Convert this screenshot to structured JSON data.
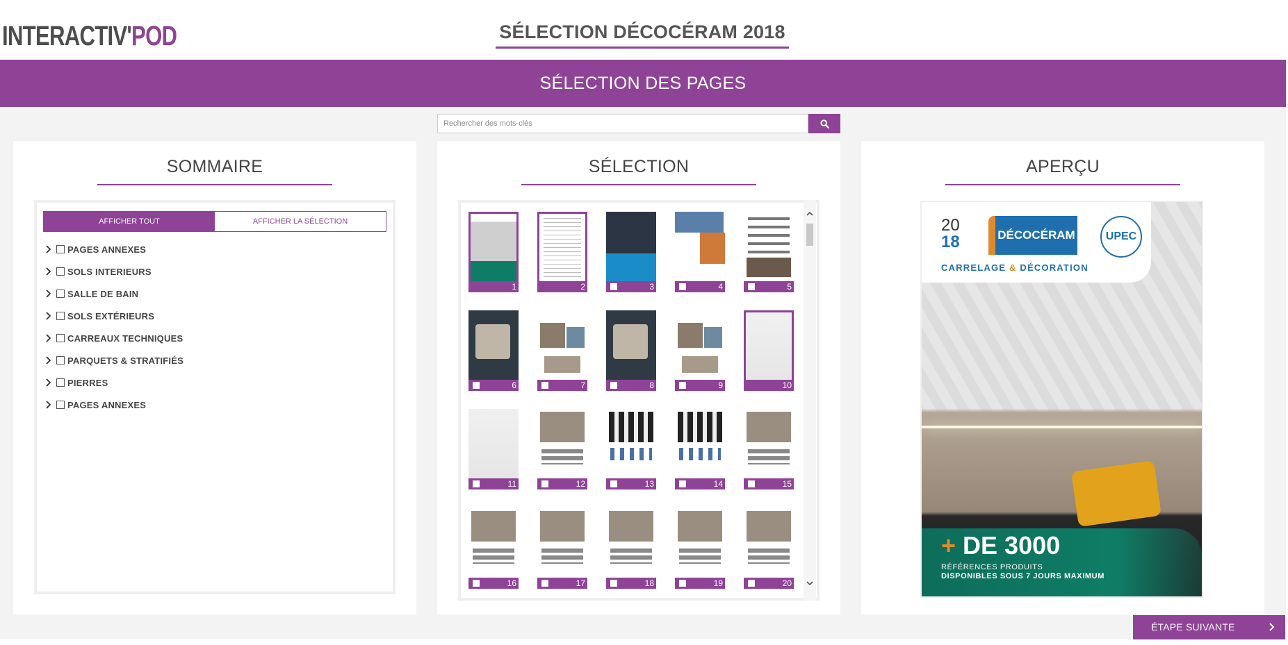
{
  "logo": {
    "part1": "INTERACTIV'",
    "part2": "POD"
  },
  "document_title": "SÉLECTION DÉCOCÉRAM 2018",
  "banner_title": "SÉLECTION DES PAGES",
  "search": {
    "placeholder": "Rechercher des mots-clés",
    "value": ""
  },
  "sommaire": {
    "title": "SOMMAIRE",
    "tabs": [
      {
        "label": "AFFICHER TOUT",
        "active": true
      },
      {
        "label": "AFFICHER LA SÉLECTION",
        "active": false
      }
    ],
    "items": [
      {
        "label": "PAGES ANNEXES"
      },
      {
        "label": "SOLS INTERIEURS"
      },
      {
        "label": "SALLE DE BAIN"
      },
      {
        "label": "SOLS EXTÉRIEURS"
      },
      {
        "label": "CARREAUX TECHNIQUES"
      },
      {
        "label": "PARQUETS & STRATIFIÉS"
      },
      {
        "label": "PIERRES"
      },
      {
        "label": "PAGES ANNEXES"
      }
    ]
  },
  "selection": {
    "title": "SÉLECTION",
    "pages": [
      {
        "num": "1",
        "selected": true,
        "style": "cover"
      },
      {
        "num": "2",
        "selected": true,
        "style": "text"
      },
      {
        "num": "3",
        "selected": false,
        "style": "dark-blue"
      },
      {
        "num": "4",
        "selected": false,
        "style": "city"
      },
      {
        "num": "5",
        "selected": false,
        "style": "brands"
      },
      {
        "num": "6",
        "selected": false,
        "style": "dark"
      },
      {
        "num": "7",
        "selected": false,
        "style": "collage"
      },
      {
        "num": "8",
        "selected": false,
        "style": "dark"
      },
      {
        "num": "9",
        "selected": false,
        "style": "collage"
      },
      {
        "num": "10",
        "selected": true,
        "style": "faded"
      },
      {
        "num": "11",
        "selected": false,
        "style": "faded"
      },
      {
        "num": "12",
        "selected": false,
        "style": "catalog"
      },
      {
        "num": "13",
        "selected": false,
        "style": "catalog-dots"
      },
      {
        "num": "14",
        "selected": false,
        "style": "catalog-dots"
      },
      {
        "num": "15",
        "selected": false,
        "style": "catalog"
      },
      {
        "num": "16",
        "selected": false,
        "style": "catalog"
      },
      {
        "num": "17",
        "selected": false,
        "style": "catalog"
      },
      {
        "num": "18",
        "selected": false,
        "style": "catalog"
      },
      {
        "num": "19",
        "selected": false,
        "style": "catalog"
      },
      {
        "num": "20",
        "selected": false,
        "style": "catalog"
      }
    ]
  },
  "apercu": {
    "title": "APERÇU",
    "year_top": "20",
    "year_bottom": "18",
    "brand": "DÉCOCÉRAM",
    "badge": "UPEC",
    "tagline_1": "CARRELAGE ",
    "tagline_amp": "&",
    "tagline_2": " DÉCORATION",
    "plus_sign": "+",
    "plus_text": " DE 3000",
    "refs_line1": "RÉFÉRENCES PRODUITS",
    "refs_line2": "DISPONIBLES SOUS 7 JOURS MAXIMUM"
  },
  "next_button": "ÉTAPE SUIVANTE",
  "colors": {
    "accent": "#8e4397",
    "brand_blue": "#1f6fae",
    "brand_orange": "#e08a2e"
  }
}
